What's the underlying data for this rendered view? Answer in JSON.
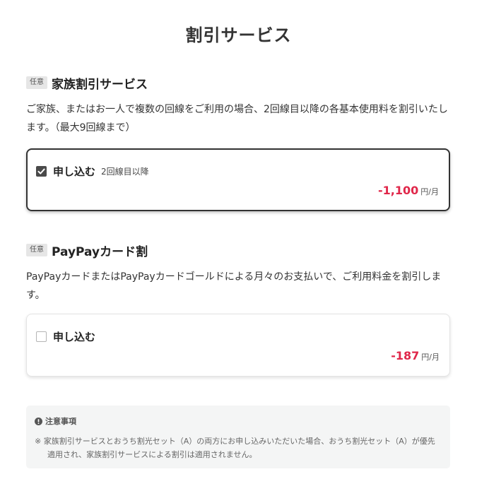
{
  "page": {
    "title": "割引サービス"
  },
  "family_discount": {
    "badge": "任意",
    "title": "家族割引サービス",
    "description": "ご家族、またはお一人で複数の回線をご利用の場合、2回線目以降の各基本使用料を割引いたします。（最大9回線まで）",
    "option": {
      "checked": true,
      "label": "申し込む",
      "note": "2回線目以降",
      "price": "-1,100",
      "unit": "円/月"
    }
  },
  "paypay_discount": {
    "badge": "任意",
    "title": "PayPayカード割",
    "description": "PayPayカードまたはPayPayカードゴールドによる月々のお支払いで、ご利用料金を割引します。",
    "option": {
      "checked": false,
      "label": "申し込む",
      "price": "-187",
      "unit": "円/月"
    }
  },
  "notice": {
    "title": "注意事項",
    "body": "※ 家族割引サービスとおうち割光セット（A）の両方にお申し込みいただいた場合、おうち割光セット（A）が優先適用され、家族割引サービスによる割引は適用されません。"
  },
  "colors": {
    "price": "#e0274a",
    "checked_box": "#4a4a4a",
    "selected_border": "#333333"
  },
  "icons": {
    "checkbox_checked": "check-icon",
    "notice": "info-icon"
  }
}
